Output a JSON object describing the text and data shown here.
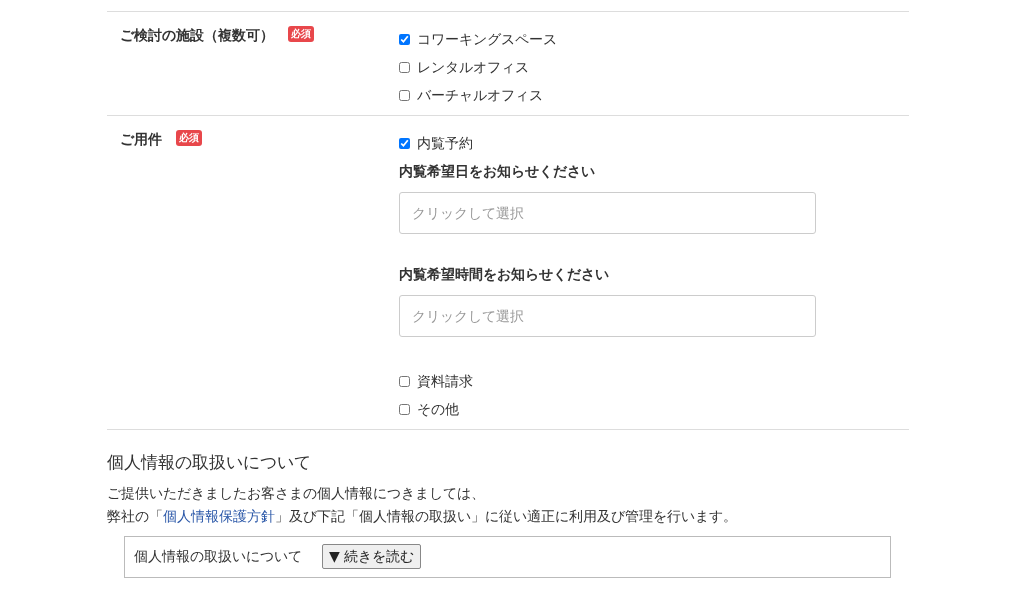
{
  "sections": [
    {
      "label": "ご検討の施設（複数可）",
      "required_badge": "必須",
      "items": [
        {
          "kind": "checkbox",
          "label": "コワーキングスペース",
          "checked": true
        },
        {
          "kind": "checkbox",
          "label": "レンタルオフィス",
          "checked": false
        },
        {
          "kind": "checkbox",
          "label": "バーチャルオフィス",
          "checked": false
        }
      ]
    },
    {
      "label": "ご用件",
      "required_badge": "必須",
      "items": [
        {
          "kind": "checkbox",
          "label": "内覧予約",
          "checked": true
        },
        {
          "kind": "field",
          "label": "内覧希望日をお知らせください",
          "placeholder": "クリックして選択"
        },
        {
          "kind": "field",
          "label": "内覧希望時間をお知らせください",
          "placeholder": "クリックして選択"
        },
        {
          "kind": "checkbox",
          "label": "資料請求",
          "checked": false
        },
        {
          "kind": "checkbox",
          "label": "その他",
          "checked": false
        }
      ]
    }
  ],
  "privacy": {
    "heading": "個人情報の取扱いについて",
    "line_1": "ご提供いただきましたお客さまの個人情報につきましては、",
    "line_2_before": "弊社の「",
    "link": "個人情報保護方針",
    "line_2_after": "」及び下記「個人情報の取扱い」に従い適正に利用及び管理を行います。",
    "box": {
      "label": "個人情報の取扱いについて",
      "button": "▼ 続きを読む"
    }
  }
}
